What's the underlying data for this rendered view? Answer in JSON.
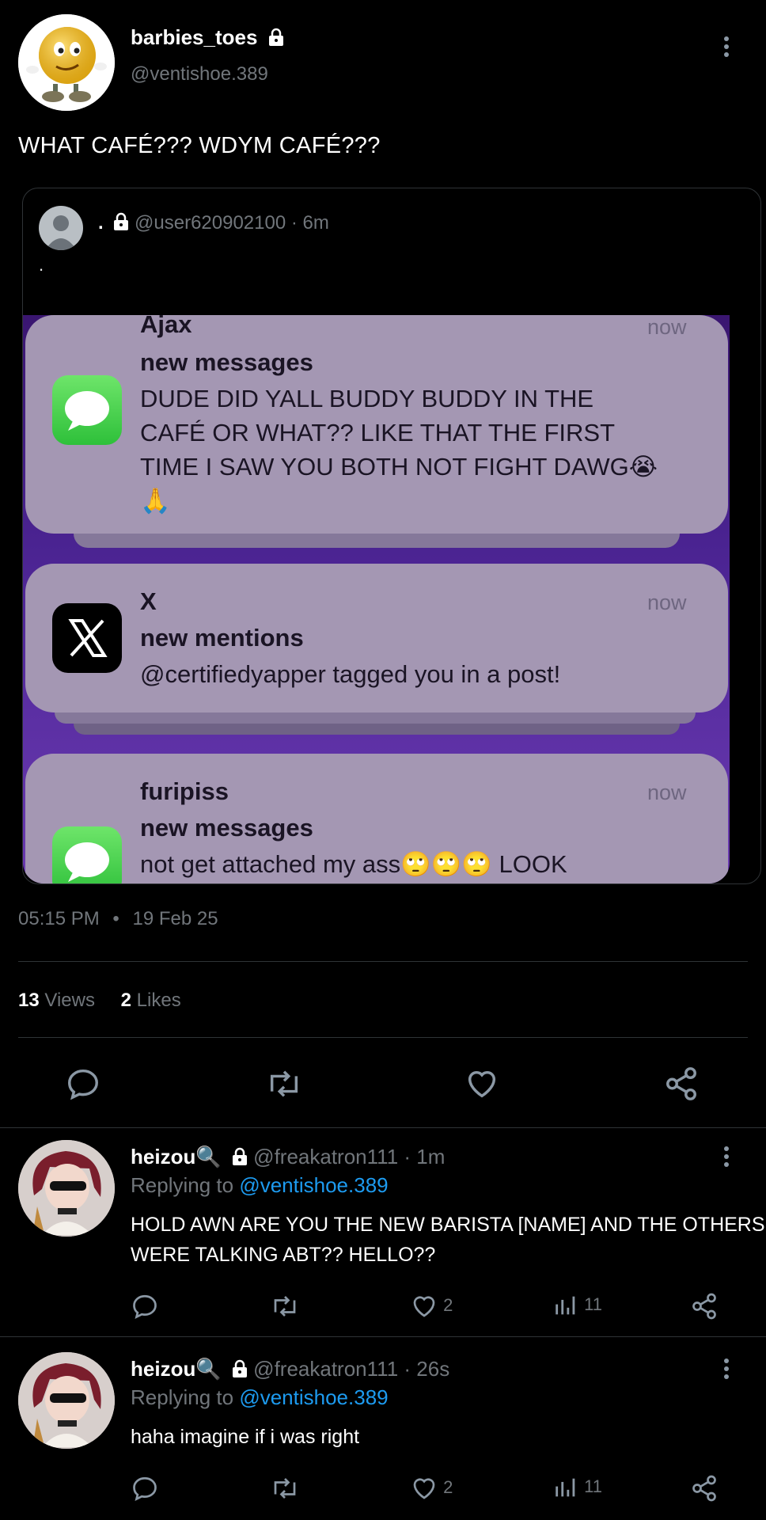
{
  "post": {
    "display_name": "barbies_toes",
    "handle": "@ventishoe.389",
    "text": "WHAT CAFÉ??? WDYM CAFÉ???",
    "time": "05:15 PM",
    "separator": "•",
    "date": "19 Feb 25",
    "views_count": "13",
    "views_label": "Views",
    "likes_count": "2",
    "likes_label": "Likes"
  },
  "quote": {
    "display_name": ".",
    "handle": "@user620902100",
    "age": "6m",
    "text": ".",
    "notifications": [
      {
        "app": "Ajax",
        "time": "now",
        "title": "new messages",
        "body_line1": "DUDE DID YALL BUDDY BUDDY IN THE",
        "body_line2": "CAFÉ OR WHAT?? LIKE THAT THE FIRST",
        "body_line3": "TIME I SAW YOU BOTH NOT FIGHT DAWG😭",
        "body_line4": "🙏",
        "icon": "messages-icon"
      },
      {
        "app": "X",
        "time": "now",
        "title": "new mentions",
        "body_line1": "@certifiedyapper tagged you in a post!",
        "icon": "x-logo-icon"
      },
      {
        "app": "furipiss",
        "time": "now",
        "title": "new messages",
        "body_line1": "not get attached my ass🙄🙄🙄 LOOK",
        "icon": "messages-icon"
      }
    ]
  },
  "actions": [
    "reply-icon",
    "retweet-icon",
    "like-icon",
    "share-icon"
  ],
  "replies": [
    {
      "display_name": "heizou🔍",
      "handle": "@freakatron111",
      "age": "1m",
      "replying_label": "Replying to",
      "replying_to": "@ventishoe.389",
      "text_line1": "HOLD AWN ARE YOU THE NEW BARISTA [NAME] AND THE OTHERS",
      "text_line2": "WERE TALKING ABT?? HELLO??",
      "likes": "2",
      "views": "11"
    },
    {
      "display_name": "heizou🔍",
      "handle": "@freakatron111",
      "age": "26s",
      "replying_label": "Replying to",
      "replying_to": "@ventishoe.389",
      "text_line1": "haha imagine if i was right",
      "likes": "2",
      "views": "11"
    }
  ],
  "colors": {
    "background": "#000000",
    "link": "#1d9bf0",
    "muted": "#71767b",
    "notification_bg": "#a497b3"
  }
}
